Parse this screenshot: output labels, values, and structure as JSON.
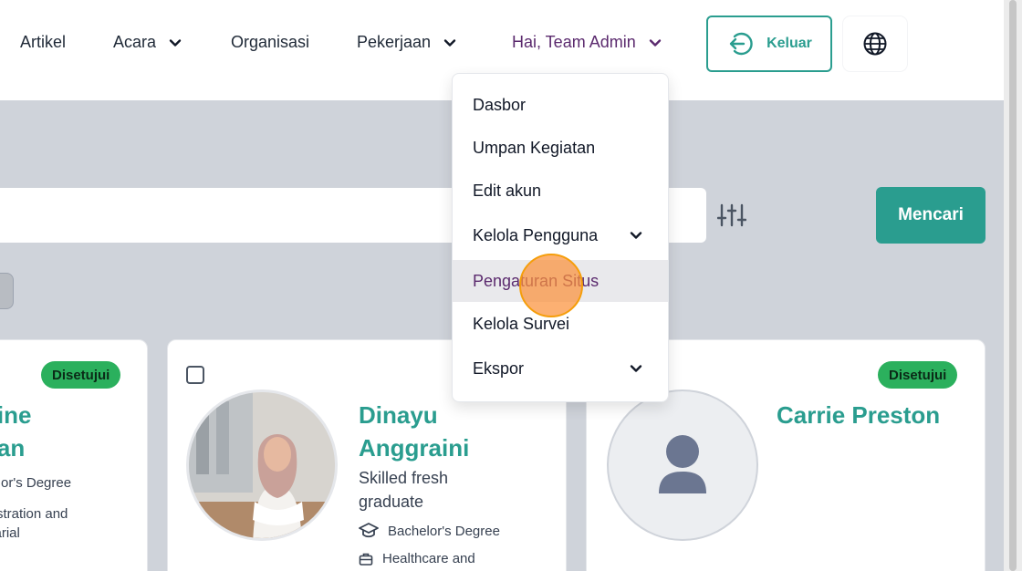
{
  "nav": {
    "items": [
      {
        "label": "Artikel"
      },
      {
        "label": "Acara"
      },
      {
        "label": "Organisasi"
      },
      {
        "label": "Pekerjaan"
      }
    ],
    "user_greeting": "Hai, Team Admin",
    "logout_label": "Keluar"
  },
  "search": {
    "button_label": "Mencari",
    "placeholder": ""
  },
  "dropdown": {
    "items": [
      {
        "label": "Dasbor"
      },
      {
        "label": "Umpan Kegiatan"
      },
      {
        "label": "Edit akun"
      },
      {
        "label": "Kelola Pengguna"
      },
      {
        "label": "Pengaturan Situs"
      },
      {
        "label": "Kelola Survei"
      },
      {
        "label": "Ekspor"
      }
    ]
  },
  "cards": [
    {
      "status": "Disetujui",
      "name_line1": "nine",
      "name_line2": "gan",
      "education": "helor's Degree",
      "field_line1": "inistration and",
      "field_line2": "etarial"
    },
    {
      "name_line1": "Dinayu",
      "name_line2": "Anggraini",
      "headline_line1": "Skilled fresh",
      "headline_line2": "graduate",
      "education": "Bachelor's Degree",
      "field": "Healthcare and"
    },
    {
      "status": "Disetujui",
      "name": "Carrie Preston"
    }
  ],
  "colors": {
    "accent": "#2a9d8f",
    "user": "#5b2a6e",
    "badge": "#2bb05d",
    "click_marker": "#fb923c"
  },
  "icons": [
    "chevron-down-icon",
    "logout-icon",
    "globe-icon",
    "filter-sliders-icon",
    "graduation-cap-icon",
    "briefcase-icon",
    "user-placeholder-icon"
  ]
}
